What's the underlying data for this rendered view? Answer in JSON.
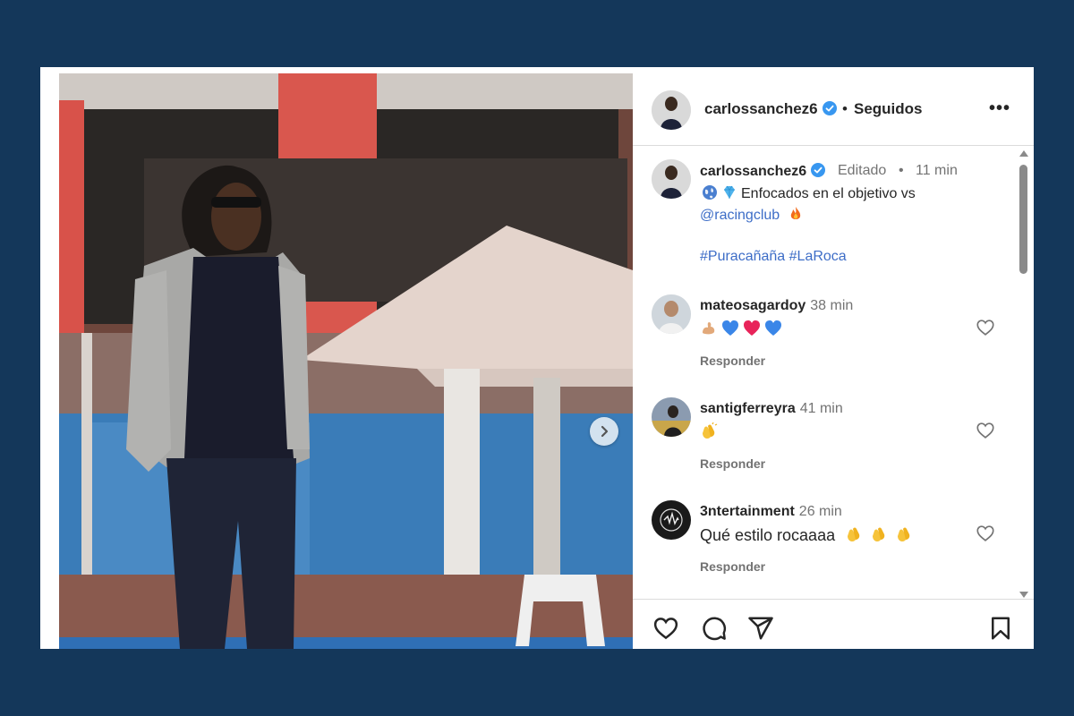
{
  "post": {
    "username": "carlossanchez6",
    "follow_status": "Seguidos",
    "more_label": "•••"
  },
  "caption": {
    "username": "carlossanchez6",
    "edited_label": "Editado",
    "time": "11 min",
    "text_line1": "Enfocados en el objetivo vs",
    "mention": "@racingclub",
    "hashtag1": "#Puracañaña",
    "hashtag2": "#LaRoca"
  },
  "comments": [
    {
      "username": "mateosagardoy",
      "time": "38 min",
      "text": "",
      "emojis": [
        "flexed-biceps",
        "blue-heart",
        "red-heart",
        "blue-heart"
      ],
      "reply": "Responder"
    },
    {
      "username": "santigferreyra",
      "time": "41 min",
      "text": "",
      "emojis": [
        "clapping-hands"
      ],
      "reply": "Responder"
    },
    {
      "username": "3ntertainment",
      "time": "26 min",
      "text": "Qué estilo rocaaaa",
      "emojis": [
        "clapping-hands",
        "clapping-hands",
        "clapping-hands"
      ],
      "reply": "Responder"
    }
  ],
  "icons": [
    "verified-badge-icon",
    "next-arrow-icon",
    "heart-icon",
    "comment-icon",
    "share-icon",
    "bookmark-icon",
    "globe-icon",
    "diamond-icon",
    "fire-icon"
  ],
  "colors": {
    "background": "#14375a",
    "link": "#3d6dc7",
    "verified": "#3897f0",
    "muted": "#737373"
  }
}
